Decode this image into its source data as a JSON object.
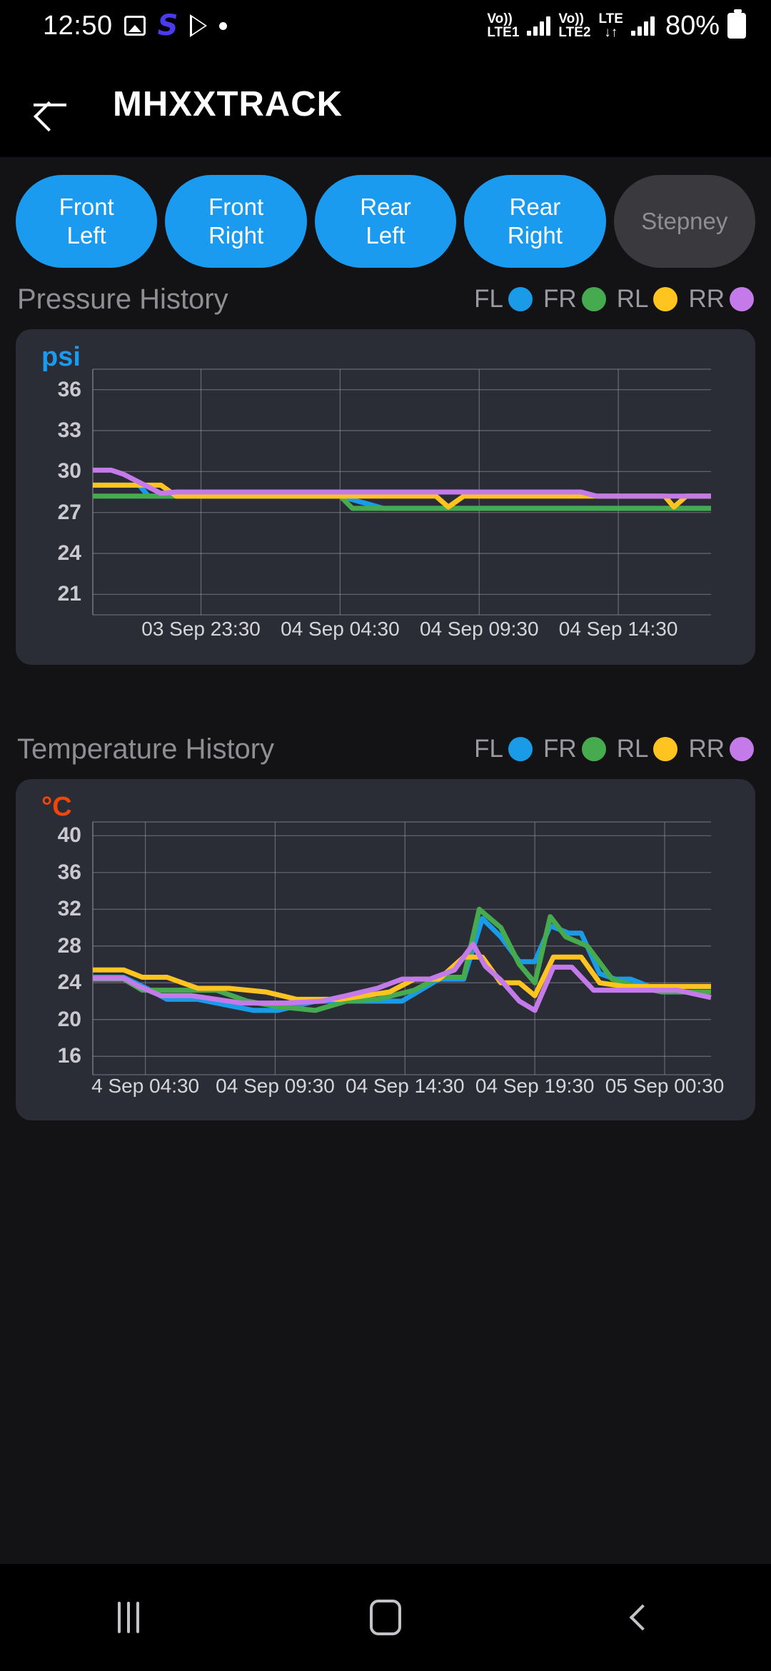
{
  "status_bar": {
    "time": "12:50",
    "icons": [
      "photo-icon",
      "s-app-icon",
      "play-store-icon",
      "dot-icon"
    ],
    "network": [
      {
        "volte": "Vo))",
        "sim": "LTE1"
      },
      {
        "volte": "Vo))",
        "sim": "LTE2"
      }
    ],
    "lte_label": "LTE",
    "data_arrows": "↓↑",
    "battery_percent": "80%"
  },
  "app_bar": {
    "back_icon": "back-arrow-icon",
    "title": "MHXXTRACK"
  },
  "tire_chips": [
    {
      "line1": "Front",
      "line2": "Left",
      "active": true
    },
    {
      "line1": "Front",
      "line2": "Right",
      "active": true
    },
    {
      "line1": "Rear",
      "line2": "Left",
      "active": true
    },
    {
      "line1": "Rear",
      "line2": "Right",
      "active": true
    },
    {
      "line1": "Stepney",
      "line2": "",
      "active": false
    }
  ],
  "legend": [
    {
      "label": "FL",
      "color": "#1a9be8"
    },
    {
      "label": "FR",
      "color": "#45ab4e"
    },
    {
      "label": "RL",
      "color": "#ffc41f"
    },
    {
      "label": "RR",
      "color": "#c47ae8"
    }
  ],
  "pressure_section": {
    "title": "Pressure History"
  },
  "temperature_section": {
    "title": "Temperature History"
  },
  "nav_bar": {
    "recent_label": "recent-apps-icon",
    "home_label": "home-icon",
    "back_label": "back-icon"
  },
  "chart_data": [
    {
      "type": "line",
      "id": "pressure-history-chart",
      "title": "Pressure History",
      "ylabel": "psi",
      "xlabel": "",
      "ylim": [
        19.5,
        37.5
      ],
      "yticks": [
        36,
        33,
        30,
        27,
        24,
        21
      ],
      "grid": true,
      "legend_position": "top-right",
      "xticks": [
        "03 Sep 23:30",
        "04 Sep 04:30",
        "04 Sep 09:30",
        "04 Sep 14:30"
      ],
      "xtick_positions": [
        0.175,
        0.4,
        0.625,
        0.85
      ],
      "series": [
        {
          "name": "FL",
          "color": "#1a9be8",
          "x": [
            0.0,
            0.04,
            0.055,
            0.075,
            0.09,
            0.11,
            0.16,
            0.4,
            0.47,
            0.49,
            1.0
          ],
          "values": [
            29.0,
            29.0,
            29.0,
            29.0,
            28.2,
            28.2,
            28.2,
            28.2,
            27.3,
            27.3,
            27.3
          ]
        },
        {
          "name": "FR",
          "color": "#45ab4e",
          "x": [
            0.0,
            0.4,
            0.42,
            0.455,
            0.475,
            1.0
          ],
          "values": [
            28.2,
            28.2,
            27.3,
            27.3,
            27.3,
            27.3
          ]
        },
        {
          "name": "RL",
          "color": "#ffc41f",
          "x": [
            0.0,
            0.04,
            0.06,
            0.11,
            0.135,
            0.165,
            0.555,
            0.575,
            0.6,
            0.625,
            0.79,
            0.815,
            0.925,
            0.94,
            0.96,
            1.0
          ],
          "values": [
            29.0,
            29.0,
            29.0,
            29.0,
            28.2,
            28.2,
            28.2,
            27.4,
            28.2,
            28.2,
            28.2,
            28.2,
            28.2,
            27.4,
            28.2,
            28.2
          ]
        },
        {
          "name": "RR",
          "color": "#c47ae8",
          "x": [
            0.0,
            0.03,
            0.05,
            0.11,
            0.135,
            0.33,
            0.35,
            0.79,
            0.815,
            1.0
          ],
          "values": [
            30.1,
            30.1,
            29.8,
            28.4,
            28.5,
            28.5,
            28.5,
            28.5,
            28.2,
            28.2
          ]
        }
      ]
    },
    {
      "type": "line",
      "id": "temperature-history-chart",
      "title": "Temperature History",
      "ylabel": "°C",
      "xlabel": "",
      "ylim": [
        14,
        41.5
      ],
      "yticks": [
        40,
        36,
        32,
        28,
        24,
        20,
        16
      ],
      "grid": true,
      "legend_position": "top-right",
      "xticks": [
        "4 Sep 04:30",
        "04 Sep 09:30",
        "04 Sep 14:30",
        "04 Sep 19:30",
        "05 Sep 00:30"
      ],
      "xtick_positions": [
        0.085,
        0.295,
        0.505,
        0.715,
        0.925
      ],
      "series": [
        {
          "name": "FL",
          "color": "#1a9be8",
          "x": [
            0.0,
            0.05,
            0.09,
            0.12,
            0.17,
            0.26,
            0.3,
            0.36,
            0.4,
            0.45,
            0.5,
            0.56,
            0.6,
            0.63,
            0.66,
            0.69,
            0.715,
            0.74,
            0.77,
            0.79,
            0.82,
            0.845,
            0.87,
            0.9,
            0.94,
            1.0
          ],
          "values": [
            24.6,
            24.6,
            23.3,
            22.2,
            22.2,
            21.0,
            21.0,
            22.0,
            22.0,
            22.0,
            22.0,
            24.4,
            24.4,
            31.0,
            29.0,
            26.3,
            26.3,
            30.2,
            29.4,
            29.4,
            25.0,
            24.4,
            24.4,
            23.6,
            23.6,
            23.6
          ]
        },
        {
          "name": "FR",
          "color": "#45ab4e",
          "x": [
            0.0,
            0.05,
            0.08,
            0.12,
            0.2,
            0.25,
            0.3,
            0.36,
            0.41,
            0.46,
            0.52,
            0.56,
            0.6,
            0.625,
            0.66,
            0.69,
            0.715,
            0.74,
            0.765,
            0.8,
            0.84,
            0.88,
            0.92,
            1.0
          ],
          "values": [
            24.4,
            24.4,
            23.2,
            23.2,
            23.2,
            22.0,
            21.4,
            21.0,
            22.0,
            22.2,
            23.2,
            24.6,
            24.6,
            32.0,
            30.0,
            26.0,
            24.0,
            31.2,
            29.0,
            28.0,
            24.4,
            23.6,
            23.0,
            23.0
          ]
        },
        {
          "name": "RL",
          "color": "#ffc41f",
          "x": [
            0.0,
            0.05,
            0.08,
            0.12,
            0.17,
            0.22,
            0.28,
            0.33,
            0.4,
            0.48,
            0.52,
            0.56,
            0.6,
            0.63,
            0.66,
            0.69,
            0.715,
            0.745,
            0.79,
            0.82,
            0.86,
            0.9,
            1.0
          ],
          "values": [
            25.4,
            25.4,
            24.6,
            24.6,
            23.4,
            23.4,
            23.0,
            22.2,
            22.2,
            23.0,
            24.4,
            24.4,
            26.8,
            26.8,
            24.0,
            24.0,
            22.6,
            26.8,
            26.8,
            24.0,
            23.6,
            23.6,
            23.6
          ]
        },
        {
          "name": "RR",
          "color": "#c47ae8",
          "x": [
            0.0,
            0.05,
            0.075,
            0.11,
            0.16,
            0.24,
            0.31,
            0.37,
            0.41,
            0.46,
            0.5,
            0.545,
            0.585,
            0.615,
            0.635,
            0.66,
            0.69,
            0.715,
            0.745,
            0.775,
            0.81,
            0.88,
            0.945,
            1.0
          ],
          "values": [
            24.5,
            24.5,
            23.6,
            22.6,
            22.6,
            21.8,
            21.8,
            22.0,
            22.6,
            23.4,
            24.4,
            24.4,
            25.4,
            28.2,
            25.8,
            24.3,
            22.0,
            21.0,
            25.7,
            25.7,
            23.2,
            23.2,
            23.2,
            22.4
          ]
        }
      ]
    }
  ]
}
